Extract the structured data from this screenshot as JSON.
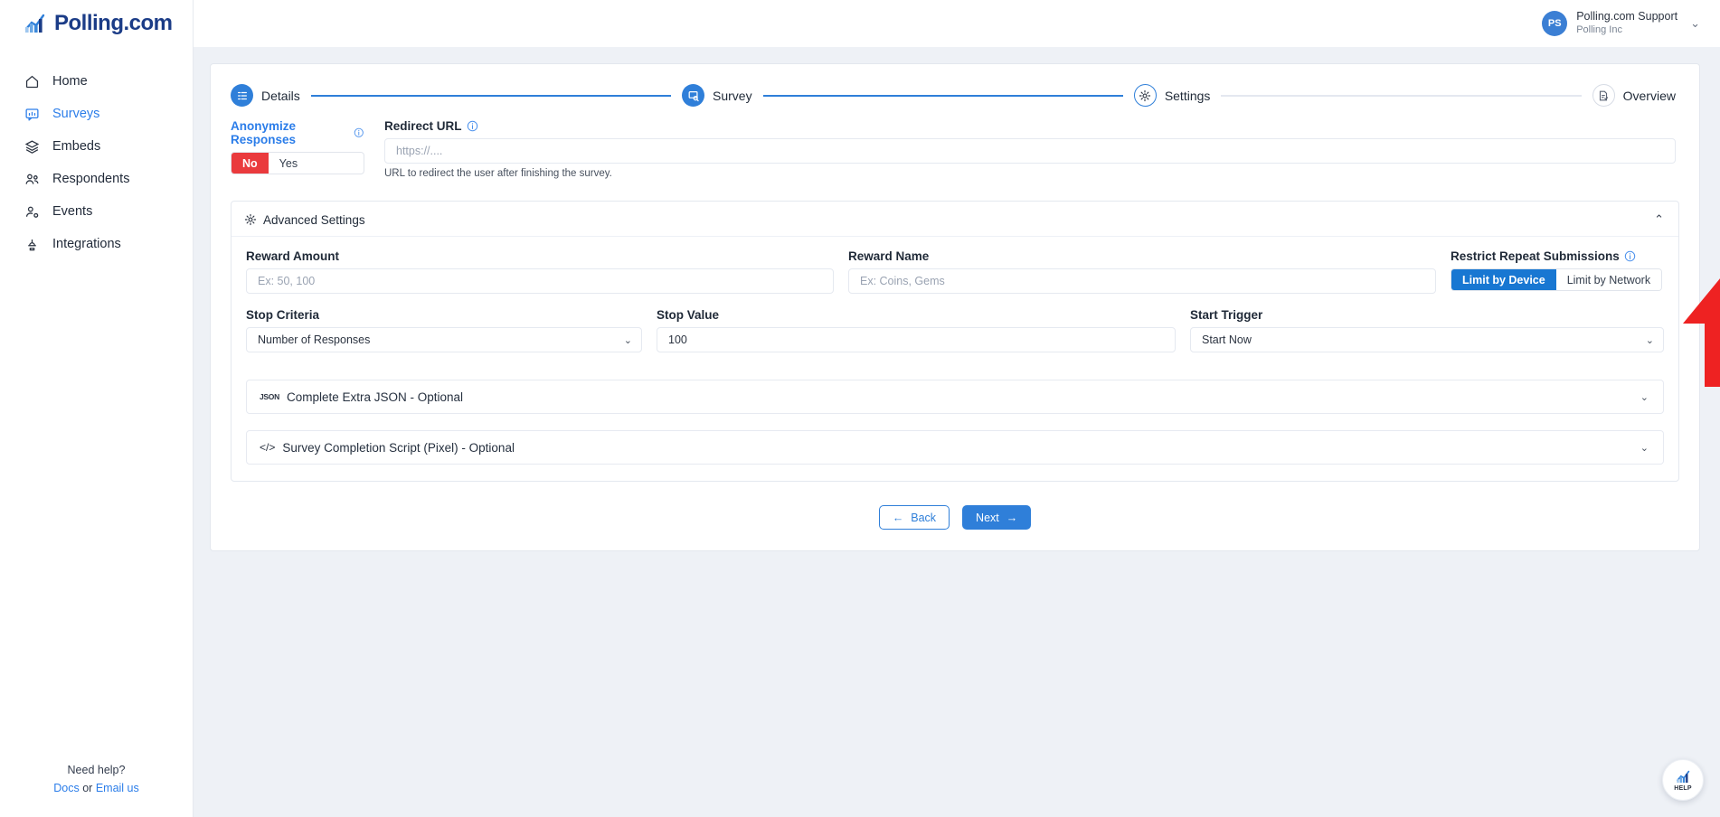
{
  "brand": {
    "name": "Polling.com",
    "logo_icon": "polling-bar-chart-logo",
    "accent_blue": "#2f7fd9",
    "accent_red": "#ea3a3d",
    "logo_navy": "#1b3c87"
  },
  "sidebar": {
    "items": [
      {
        "label": "Home",
        "icon": "home-icon",
        "active": false
      },
      {
        "label": "Surveys",
        "icon": "survey-chat-icon",
        "active": true
      },
      {
        "label": "Embeds",
        "icon": "layers-icon",
        "active": false
      },
      {
        "label": "Respondents",
        "icon": "users-icon",
        "active": false
      },
      {
        "label": "Events",
        "icon": "user-gear-icon",
        "active": false
      },
      {
        "label": "Integrations",
        "icon": "plug-icon",
        "active": false
      }
    ],
    "footer": {
      "need_help": "Need help?",
      "docs": "Docs",
      "or": "or",
      "email": "Email us"
    }
  },
  "topbar": {
    "account": {
      "initials": "PS",
      "name": "Polling.com Support",
      "org": "Polling Inc",
      "caret_icon": "chevron-down-icon"
    }
  },
  "stepper": {
    "steps": [
      {
        "label": "Details",
        "icon": "list-details-icon",
        "state": "done"
      },
      {
        "label": "Survey",
        "icon": "survey-search-icon",
        "state": "done"
      },
      {
        "label": "Settings",
        "icon": "gear-icon",
        "state": "current"
      },
      {
        "label": "Overview",
        "icon": "document-check-icon",
        "state": "todo"
      }
    ]
  },
  "form": {
    "anonymize": {
      "label": "Anonymize Responses",
      "info_icon": "info-circle-icon",
      "options": [
        "No",
        "Yes"
      ],
      "selected": "No"
    },
    "redirect_url": {
      "label": "Redirect URL",
      "info_icon": "info-circle-icon",
      "value": "",
      "placeholder": "https://....",
      "hint": "URL to redirect the user after finishing the survey."
    }
  },
  "advanced": {
    "title": "Advanced Settings",
    "icon": "gear-icon",
    "collapse_icon": "chevron-up-icon",
    "expanded": true,
    "reward_amount": {
      "label": "Reward Amount",
      "value": "",
      "placeholder": "Ex: 50, 100"
    },
    "reward_name": {
      "label": "Reward Name",
      "value": "",
      "placeholder": "Ex: Coins, Gems"
    },
    "restrict_repeat": {
      "label": "Restrict Repeat Submissions",
      "info_icon": "info-circle-icon",
      "options": [
        "Limit by Device",
        "Limit by Network"
      ],
      "selected": "Limit by Device"
    },
    "stop_criteria": {
      "label": "Stop Criteria",
      "value": "Number of Responses",
      "caret_icon": "chevron-down-icon"
    },
    "stop_value": {
      "label": "Stop Value",
      "value": "100",
      "placeholder": ""
    },
    "start_trigger": {
      "label": "Start Trigger",
      "value": "Start Now",
      "caret_icon": "chevron-down-icon"
    },
    "extra_json": {
      "label": "Complete Extra JSON - Optional",
      "badge": "JSON",
      "caret_icon": "chevron-down-icon"
    },
    "completion_script": {
      "label": "Survey Completion Script (Pixel) - Optional",
      "badge": "</>",
      "caret_icon": "chevron-down-icon"
    }
  },
  "footer_buttons": {
    "back": "Back",
    "back_icon": "arrow-left-icon",
    "next": "Next",
    "next_icon": "arrow-right-icon"
  },
  "annotation": {
    "type": "red-arrow-up",
    "color": "#ee2222",
    "points_at": "Limit by Device"
  },
  "help_widget": {
    "label": "HELP",
    "icon": "polling-bar-chart-logo"
  }
}
